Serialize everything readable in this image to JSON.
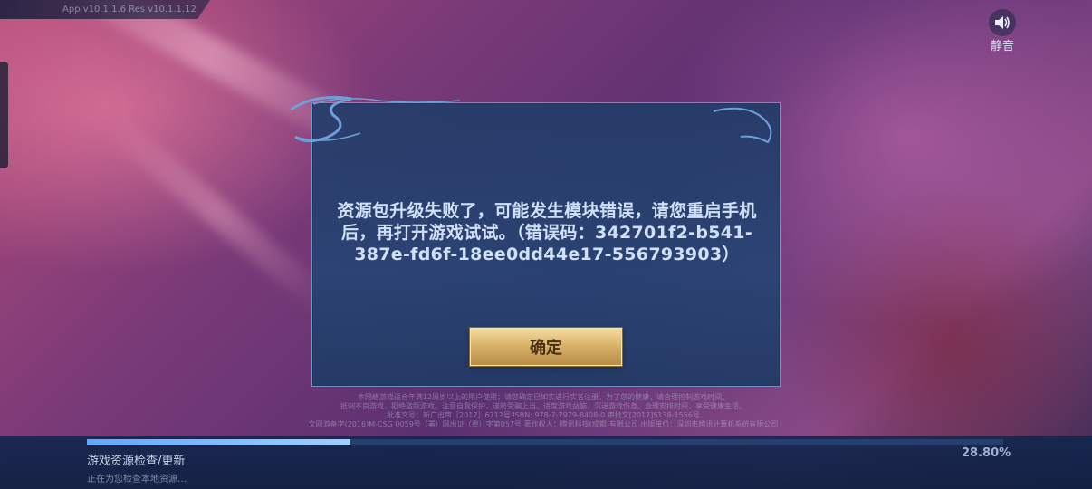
{
  "top": {
    "version_text": "App v10.1.1.6   Res v10.1.1.12"
  },
  "mute": {
    "icon": "speaker-icon",
    "label": "静音"
  },
  "dialog": {
    "message": "资源包升级失败了，可能发生模块错误，请您重启手机后，再打开游戏试试。（错误码：342701f2-b541-387e-fd6f-18ee0dd44e17-556793903）",
    "confirm_label": "确定"
  },
  "notice": {
    "lines": [
      "本网络游戏适合年满12周岁以上的用户使用；请您确定已如实进行实名注册。为了您的健康，请合理控制游戏时间。",
      "抵制不良游戏，拒绝盗版游戏。注意自我保护，谨防受骗上当。适度游戏益脑，沉迷游戏伤身。合理安排时间，享受健康生活。",
      "批准文号：新广出审［2017］6712号  ISBN: 978-7-7979-8408-0  审批文[2017]S138-1556号",
      "文网游备字(2016)M-CSG 0059号（署）网出证（粤）字第057号  著作权人：腾讯科技(成都)有限公司  出版单位：深圳市腾讯计算机系统有限公司"
    ]
  },
  "progress": {
    "title": "游戏资源检查/更新",
    "subtitle": "正在为您检查本地资源…",
    "percent_text": "28.80%",
    "fraction": 0.288
  },
  "colors": {
    "dialog_bg": "#26447a",
    "button_gold": "#d9b36b",
    "message_text": "#cfe0f7"
  }
}
